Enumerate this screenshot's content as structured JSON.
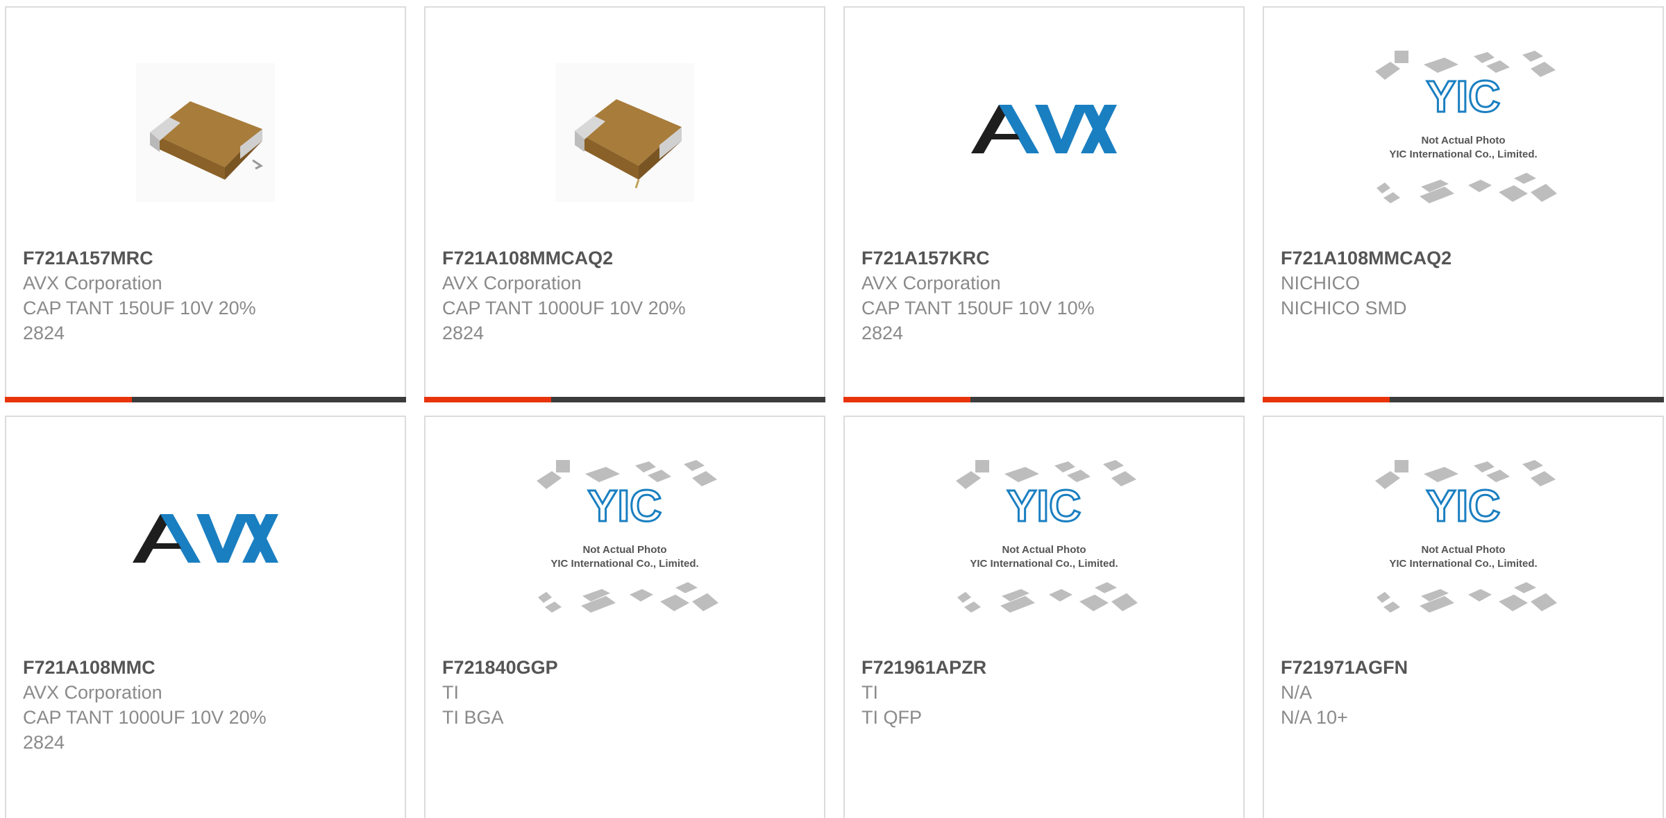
{
  "products": [
    {
      "part_number": "F721A157MRC",
      "manufacturer": "AVX Corporation",
      "description": "CAP TANT 150UF 10V 20%",
      "package": "2824",
      "image": "tantalum-capacitor-photo"
    },
    {
      "part_number": "F721A108MMCAQ2",
      "manufacturer": "AVX Corporation",
      "description": "CAP TANT 1000UF 10V 20%",
      "package": "2824",
      "image": "tantalum-capacitor-photo"
    },
    {
      "part_number": "F721A157KRC",
      "manufacturer": "AVX Corporation",
      "description": "CAP TANT 150UF 10V 10%",
      "package": "2824",
      "image": "avx-logo"
    },
    {
      "part_number": "F721A108MMCAQ2",
      "manufacturer": "NICHICO",
      "description": "NICHICO SMD",
      "image": "yic-placeholder"
    },
    {
      "part_number": "F721A108MMC",
      "manufacturer": "AVX Corporation",
      "description": "CAP TANT 1000UF 10V 20%",
      "package": "2824",
      "image": "avx-logo"
    },
    {
      "part_number": "F721840GGP",
      "manufacturer": "TI",
      "description": "TI BGA",
      "image": "yic-placeholder"
    },
    {
      "part_number": "F721961APZR",
      "manufacturer": "TI",
      "description": "TI QFP",
      "image": "yic-placeholder"
    },
    {
      "part_number": "F721971AGFN",
      "manufacturer": "N/A",
      "description": "N/A 10+",
      "image": "yic-placeholder"
    }
  ],
  "logos": {
    "avx_text": "AVX",
    "yic_text": "YIC",
    "yic_note_1": "Not Actual Photo",
    "yic_note_2": "YIC International Co., Limited."
  },
  "colors": {
    "accent_red": "#e8330b",
    "bar_dark": "#3c3c3c",
    "avx_blue": "#1a7fc1",
    "avx_black": "#1e1e1e",
    "card_border": "#dcdcdc"
  }
}
